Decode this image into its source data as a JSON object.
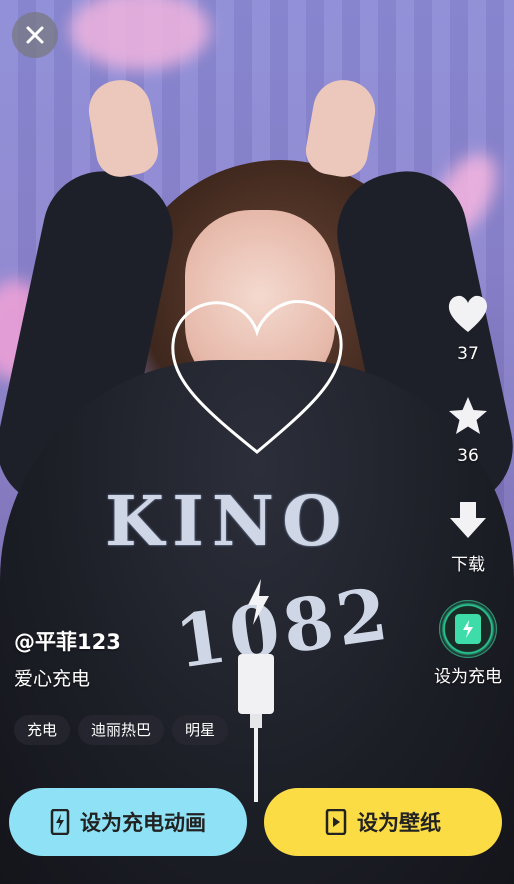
{
  "close": {
    "icon": "close-icon"
  },
  "sidebar": {
    "like": {
      "icon": "heart-icon",
      "count": "37"
    },
    "favorite": {
      "icon": "star-icon",
      "count": "36"
    },
    "download": {
      "icon": "download-icon",
      "label": "下载"
    },
    "set_charge": {
      "icon": "charging-icon",
      "label": "设为充电"
    }
  },
  "author": {
    "handle": "@平菲123"
  },
  "description": "爱心充电",
  "tags": [
    "充电",
    "迪丽热巴",
    "明星"
  ],
  "buttons": {
    "set_charge_animation": "设为充电动画",
    "set_wallpaper": "设为壁纸"
  },
  "colors": {
    "charge_button": "#8fe2f5",
    "wallpaper_button": "#fbdc45",
    "accent_green": "#3ddca8"
  }
}
